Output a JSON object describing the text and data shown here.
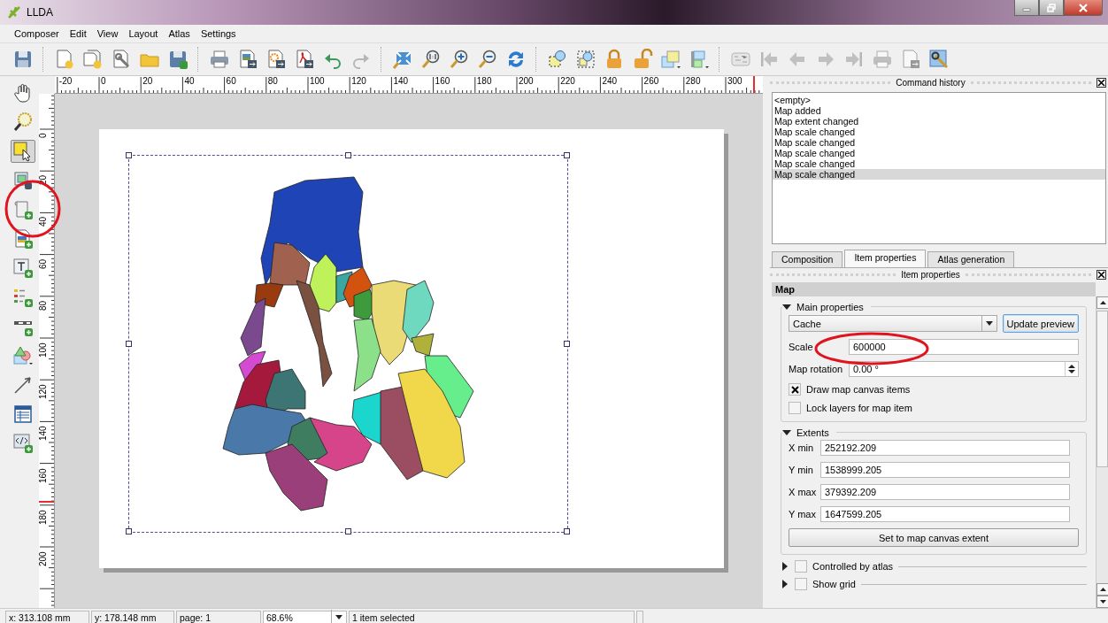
{
  "window": {
    "title": "LLDA"
  },
  "menu": [
    "Composer",
    "Edit",
    "View",
    "Layout",
    "Atlas",
    "Settings"
  ],
  "toolbar": [
    {
      "kind": "save",
      "disabled": false
    },
    {
      "kind": "separator"
    },
    {
      "kind": "new",
      "disabled": false
    },
    {
      "kind": "duplicate",
      "disabled": false
    },
    {
      "kind": "manager",
      "disabled": false
    },
    {
      "kind": "open",
      "disabled": false
    },
    {
      "kind": "saveas",
      "disabled": false
    },
    {
      "kind": "separator"
    },
    {
      "kind": "print",
      "disabled": false
    },
    {
      "kind": "export_image",
      "disabled": false
    },
    {
      "kind": "export_svg",
      "disabled": false
    },
    {
      "kind": "export_pdf",
      "disabled": false
    },
    {
      "kind": "undo",
      "disabled": false
    },
    {
      "kind": "redo",
      "disabled": true
    },
    {
      "kind": "separator"
    },
    {
      "kind": "zoom_full",
      "disabled": false
    },
    {
      "kind": "zoom_actual",
      "disabled": false
    },
    {
      "kind": "zoom_in",
      "disabled": false
    },
    {
      "kind": "zoom_out",
      "disabled": false
    },
    {
      "kind": "refresh",
      "disabled": false
    },
    {
      "kind": "separator"
    },
    {
      "kind": "select_items",
      "disabled": false
    },
    {
      "kind": "select_all",
      "disabled": false
    },
    {
      "kind": "lock",
      "disabled": false
    },
    {
      "kind": "unlock",
      "disabled": false
    },
    {
      "kind": "raise",
      "disabled": false
    },
    {
      "kind": "align",
      "disabled": false
    },
    {
      "kind": "separator"
    },
    {
      "kind": "atlas_preview",
      "disabled": true
    },
    {
      "kind": "first",
      "disabled": true
    },
    {
      "kind": "prev",
      "disabled": true
    },
    {
      "kind": "next",
      "disabled": true
    },
    {
      "kind": "last",
      "disabled": true
    },
    {
      "kind": "atlas_print",
      "disabled": true
    },
    {
      "kind": "atlas_export",
      "disabled": true
    },
    {
      "kind": "atlas_settings",
      "disabled": false
    }
  ],
  "tools": [
    {
      "kind": "pan",
      "selected": false
    },
    {
      "kind": "zoom",
      "selected": false
    },
    {
      "kind": "select",
      "selected": true
    },
    {
      "kind": "move_content",
      "selected": false
    },
    {
      "kind": "add_map",
      "selected": false
    },
    {
      "kind": "add_image",
      "selected": false
    },
    {
      "kind": "add_label",
      "selected": false
    },
    {
      "kind": "add_legend",
      "selected": false
    },
    {
      "kind": "add_scalebar",
      "selected": false
    },
    {
      "kind": "add_shape",
      "selected": false
    },
    {
      "kind": "add_arrow",
      "selected": false
    },
    {
      "kind": "add_table",
      "selected": false
    },
    {
      "kind": "add_html",
      "selected": false
    }
  ],
  "ruler_h": [
    "-20",
    "0",
    "20",
    "40",
    "60",
    "80",
    "100",
    "120",
    "140",
    "160",
    "180",
    "200",
    "220",
    "240",
    "260",
    "280",
    "300"
  ],
  "ruler_v": [
    "0",
    "20",
    "40",
    "60",
    "80",
    "100",
    "120",
    "140",
    "160",
    "180",
    "200"
  ],
  "command_history": {
    "title": "Command history",
    "items": [
      {
        "label": "<empty>",
        "selected": false
      },
      {
        "label": "Map added",
        "selected": false
      },
      {
        "label": "Map extent changed",
        "selected": false
      },
      {
        "label": "Map scale changed",
        "selected": false
      },
      {
        "label": "Map scale changed",
        "selected": false
      },
      {
        "label": "Map scale changed",
        "selected": false
      },
      {
        "label": "Map scale changed",
        "selected": false
      },
      {
        "label": "Map scale changed",
        "selected": true
      }
    ]
  },
  "tabs": [
    {
      "label": "Composition",
      "selected": false
    },
    {
      "label": "Item properties",
      "selected": true
    },
    {
      "label": "Atlas generation",
      "selected": false
    }
  ],
  "item_properties": {
    "title": "Item properties",
    "item_type": "Map",
    "main_properties": {
      "title": "Main properties",
      "expanded": true,
      "preview_mode": "Cache",
      "update_button": "Update preview",
      "scale_label": "Scale",
      "scale": "600000",
      "rotation_label": "Map rotation",
      "rotation": "0.00 °",
      "checks": [
        {
          "label": "Draw map canvas items",
          "checked": true
        },
        {
          "label": "Lock layers for map item",
          "checked": false
        }
      ]
    },
    "extents": {
      "title": "Extents",
      "expanded": true,
      "fields": [
        {
          "label": "X min",
          "value": "252192.209"
        },
        {
          "label": "Y min",
          "value": "1538999.205"
        },
        {
          "label": "X max",
          "value": "379392.209"
        },
        {
          "label": "Y max",
          "value": "1647599.205"
        }
      ],
      "button": "Set to map canvas extent"
    },
    "sections": [
      {
        "label": "Controlled by atlas",
        "checked": false,
        "expanded": false
      },
      {
        "label": "Show grid",
        "checked": false,
        "expanded": false
      }
    ]
  },
  "status_bar": {
    "x": "x: 313.108 mm",
    "y": "y: 178.148 mm",
    "page": "page: 1",
    "zoom": "68.6%",
    "message": "1 item selected"
  }
}
